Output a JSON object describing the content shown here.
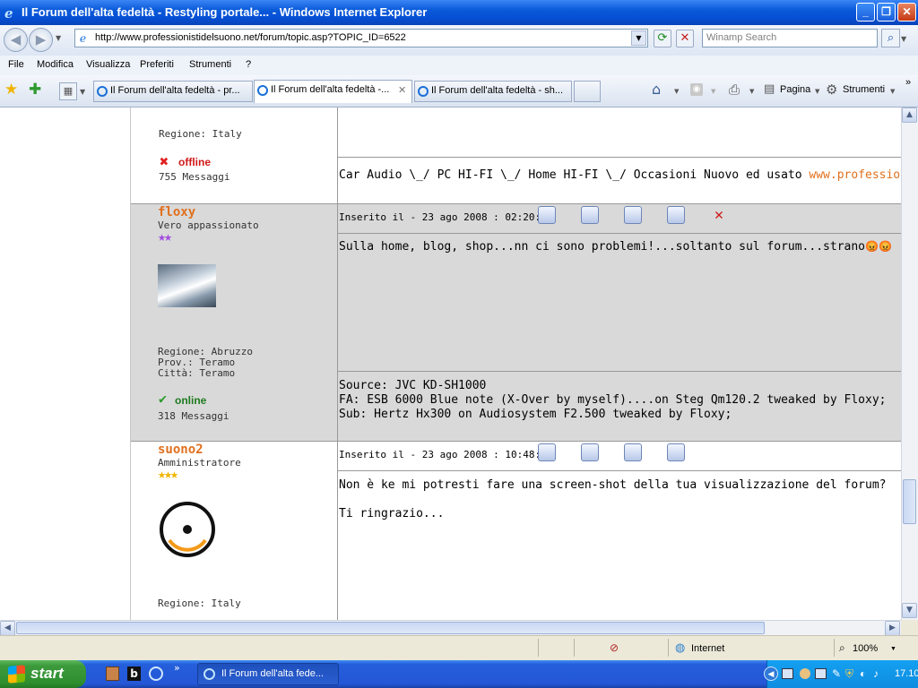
{
  "window": {
    "title": "Il Forum dell'alta fedeltà - Restyling portale... - Windows Internet Explorer",
    "minimize_glyph": "_",
    "maximize_glyph": "❐",
    "close_glyph": "✕"
  },
  "address_bar": {
    "url": "http://www.professionistidelsuono.net/forum/topic.asp?TOPIC_ID=6522",
    "search_placeholder": "Winamp Search"
  },
  "menu": [
    "File",
    "Modifica",
    "Visualizza",
    "Preferiti",
    "Strumenti",
    "?"
  ],
  "tabs": [
    {
      "label": "Il Forum dell'alta fedeltà - pr..."
    },
    {
      "label": "Il Forum dell'alta fedeltà -..."
    },
    {
      "label": "Il Forum dell'alta fedeltà - sh..."
    }
  ],
  "toolbar": {
    "page_label": "Pagina",
    "tools_label": "Strumenti",
    "more_glyph": "»"
  },
  "forum": {
    "prev_post": {
      "region": "Regione: Italy",
      "status": "offline",
      "messages": "755 Messaggi",
      "signature_text": "Car Audio \\_/ PC HI-FI \\_/ Home HI-FI \\_/ Occasioni Nuovo ed usato",
      "signature_link": "www.professionistidelsuono"
    },
    "posts": [
      {
        "author": "floxy",
        "rank": "Vero appassionato",
        "stars": "★★",
        "region": "Regione: Abruzzo",
        "prov": "Prov.: Teramo",
        "city": "Città: Teramo",
        "status": "online",
        "messages": "318 Messaggi",
        "date": "Inserito il - 23 ago 2008 : 02:20:23",
        "body": "Sulla home, blog, shop...nn ci sono problemi!...soltanto sul forum...strano",
        "emoticons": "😡😡",
        "signature": [
          "Source: JVC KD-SH1000",
          "FA: ESB 6000 Blue note (X-Over by myself)....on Steg Qm120.2 tweaked by Floxy;",
          "Sub: Hertz Hx300 on Audiosystem F2.500 tweaked by Floxy;"
        ]
      },
      {
        "author": "suono2",
        "rank": "Amministratore",
        "stars": "★★★",
        "region": "Regione: Italy",
        "date": "Inserito il - 23 ago 2008 : 10:48:46",
        "body_lines": [
          "Non è ke mi potresti fare una screen-shot della tua visualizzazione del forum?",
          "Ti ringrazio..."
        ]
      }
    ]
  },
  "status_bar": {
    "zone": "Internet",
    "zoom": "100%"
  },
  "taskbar": {
    "start_label": "start",
    "task_label": "Il Forum dell'alta fede...",
    "clock": "17.10",
    "more_glyph": "»"
  },
  "colors": {
    "accent_orange": "#e0701e",
    "title_bar_blue": "#0a5ad9",
    "post_grey": "#d9d9d9"
  }
}
